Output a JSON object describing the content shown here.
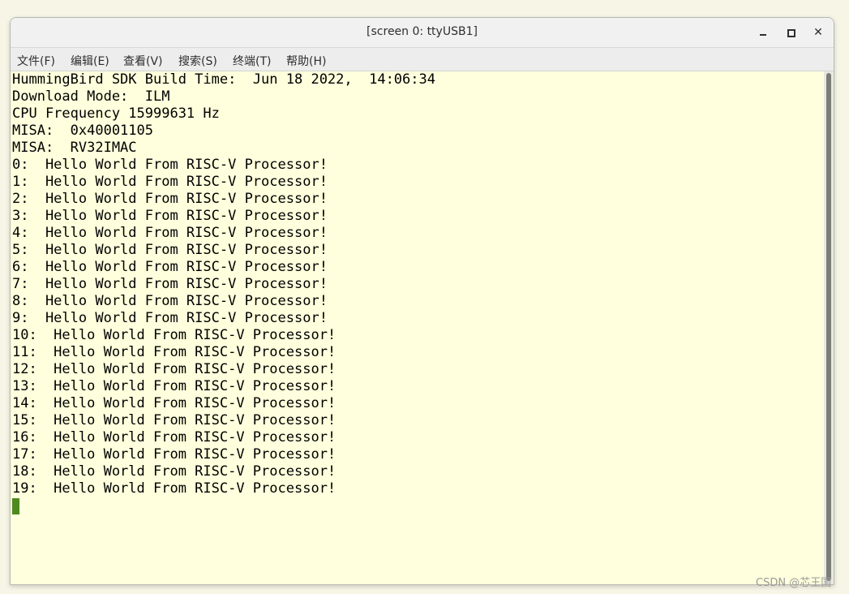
{
  "window": {
    "title": "[screen 0: ttyUSB1]",
    "minimize_icon": "minimize-icon",
    "maximize_icon": "maximize-icon",
    "close_icon": "close-icon",
    "close_glyph": "✕"
  },
  "menu": {
    "items": [
      {
        "label": "文件(F)"
      },
      {
        "label": "编辑(E)"
      },
      {
        "label": "查看(V)"
      },
      {
        "label": "搜索(S)"
      },
      {
        "label": "终端(T)"
      },
      {
        "label": "帮助(H)"
      }
    ]
  },
  "terminal": {
    "background": "#ffffdd",
    "text_color": "#000000",
    "cursor_color": "#4e8a1f",
    "lines": [
      "HummingBird SDK Build Time:  Jun 18 2022,  14:06:34",
      "Download Mode:  ILM",
      "CPU Frequency 15999631 Hz",
      "MISA:  0x40001105",
      "MISA:  RV32IMAC",
      "0:  Hello World From RISC-V Processor!",
      "1:  Hello World From RISC-V Processor!",
      "2:  Hello World From RISC-V Processor!",
      "3:  Hello World From RISC-V Processor!",
      "4:  Hello World From RISC-V Processor!",
      "5:  Hello World From RISC-V Processor!",
      "6:  Hello World From RISC-V Processor!",
      "7:  Hello World From RISC-V Processor!",
      "8:  Hello World From RISC-V Processor!",
      "9:  Hello World From RISC-V Processor!",
      "10:  Hello World From RISC-V Processor!",
      "11:  Hello World From RISC-V Processor!",
      "12:  Hello World From RISC-V Processor!",
      "13:  Hello World From RISC-V Processor!",
      "14:  Hello World From RISC-V Processor!",
      "15:  Hello World From RISC-V Processor!",
      "16:  Hello World From RISC-V Processor!",
      "17:  Hello World From RISC-V Processor!",
      "18:  Hello World From RISC-V Processor!",
      "19:  Hello World From RISC-V Processor!"
    ]
  },
  "watermark": "CSDN @芯王国"
}
